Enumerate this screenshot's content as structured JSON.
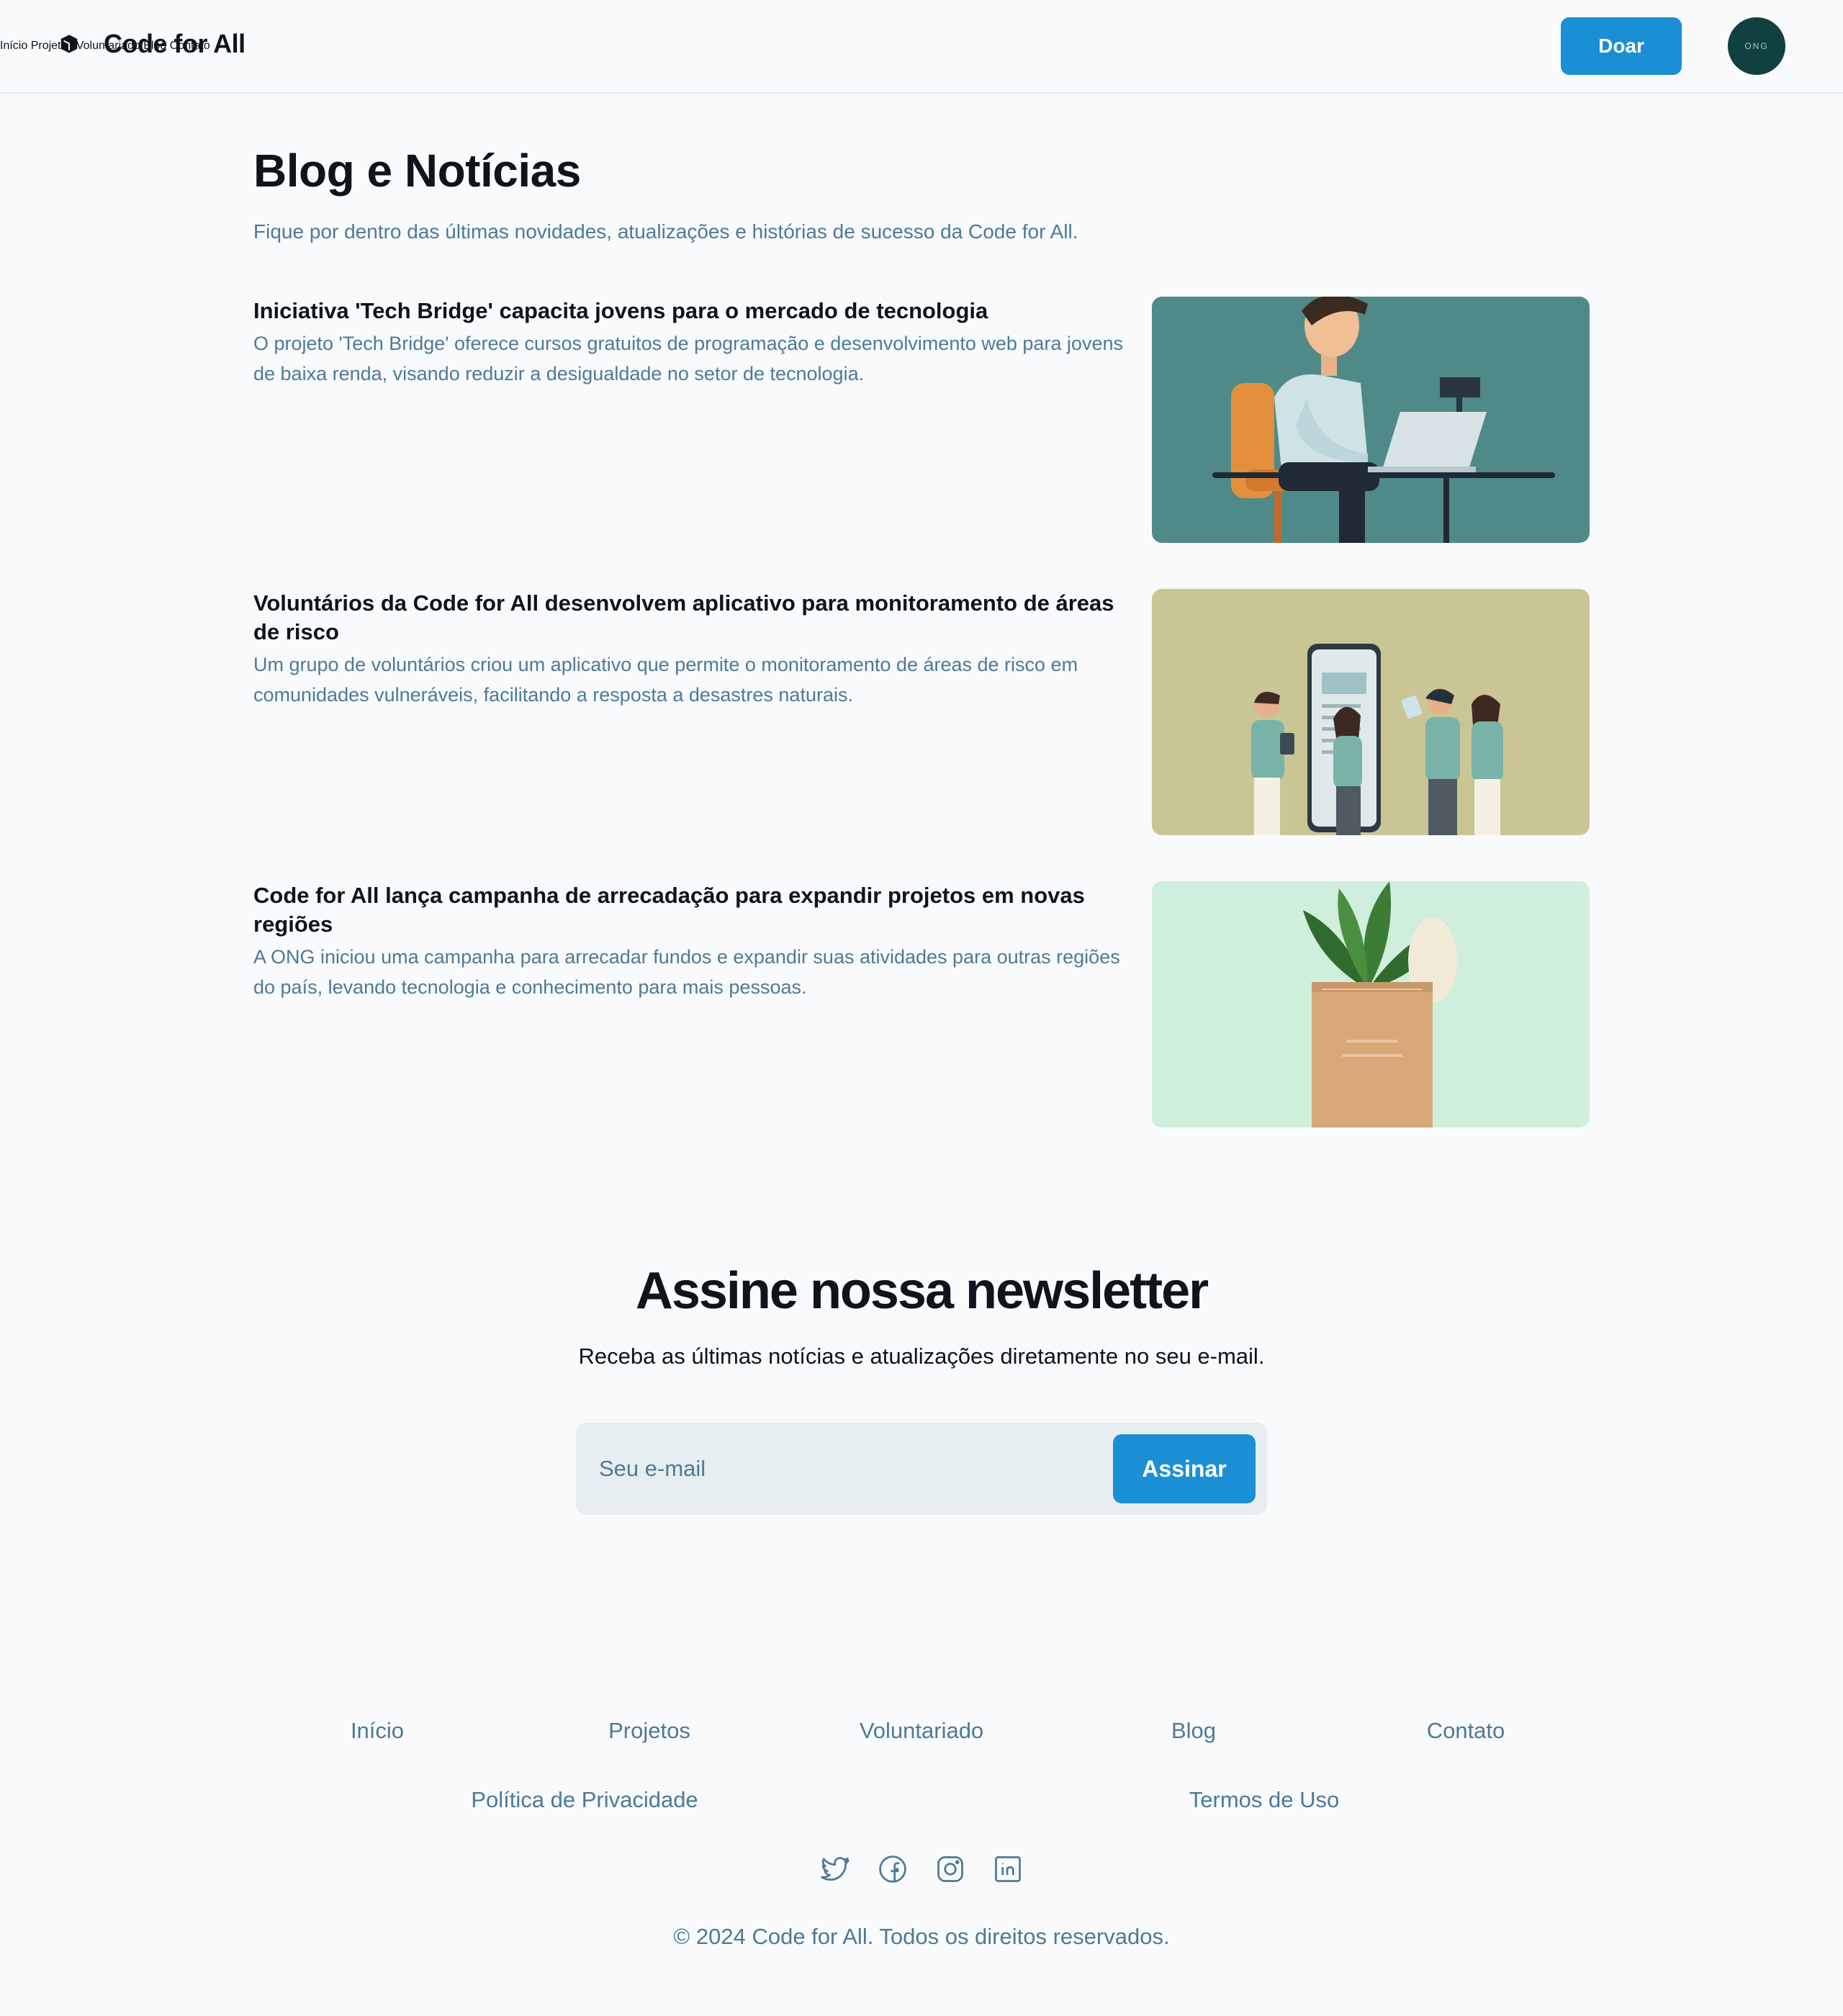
{
  "header": {
    "brand": "Code for All",
    "nav": [
      "Início",
      "Projetos",
      "Voluntariado",
      "Blog",
      "Contato"
    ],
    "donate_label": "Doar",
    "avatar_text": "ONG"
  },
  "blog": {
    "title": "Blog e Notícias",
    "subtitle": "Fique por dentro das últimas novidades, atualizações e histórias de sucesso da Code for All.",
    "posts": [
      {
        "title": "Iniciativa 'Tech Bridge' capacita jovens para o mercado de tecnologia",
        "summary": "O projeto 'Tech Bridge' oferece cursos gratuitos de programação e desenvolvimento web para jovens de baixa renda, visando reduzir a desigualdade no setor de tecnologia."
      },
      {
        "title": "Voluntários da Code for All desenvolvem aplicativo para monitoramento de áreas de risco",
        "summary": "Um grupo de voluntários criou um aplicativo que permite o monitoramento de áreas de risco em comunidades vulneráveis, facilitando a resposta a desastres naturais."
      },
      {
        "title": "Code for All lança campanha de arrecadação para expandir projetos em novas regiões",
        "summary": "A ONG iniciou uma campanha para arrecadar fundos e expandir suas atividades para outras regiões do país, levando tecnologia e conhecimento para mais pessoas."
      }
    ]
  },
  "newsletter": {
    "title": "Assine nossa newsletter",
    "subtitle": "Receba as últimas notícias e atualizações diretamente no seu e-mail.",
    "placeholder": "Seu e-mail",
    "button_label": "Assinar"
  },
  "footer": {
    "links": [
      "Início",
      "Projetos",
      "Voluntariado",
      "Blog",
      "Contato",
      "Política de Privacidade",
      "Termos de Uso"
    ],
    "social_icons": [
      "twitter-icon",
      "facebook-icon",
      "instagram-icon",
      "linkedin-icon"
    ],
    "copyright": "© 2024 Code for All. Todos os direitos reservados."
  },
  "colors": {
    "accent": "#1b8fd6",
    "muted_text": "#4e7a97",
    "background": "#f8fafb"
  }
}
